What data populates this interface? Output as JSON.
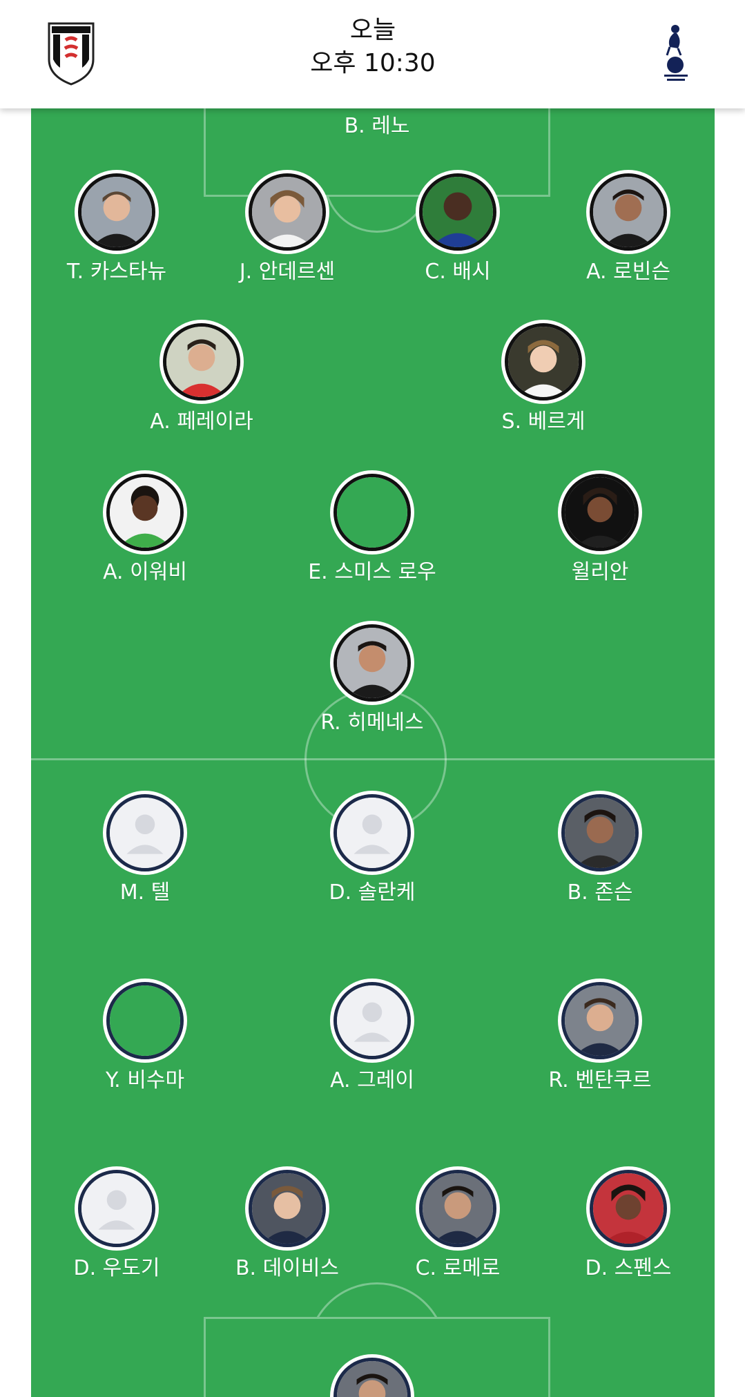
{
  "header": {
    "day_label": "오늘",
    "time_label": "오후 10:30",
    "home_logo_icon": "fulham-crest-icon",
    "away_logo_icon": "tottenham-crest-icon"
  },
  "colors": {
    "pitch": "#34a853",
    "home_ring": "#111111",
    "away_ring": "#1c2a4a"
  },
  "home_team": {
    "goalkeeper": {
      "name": "B. 레노"
    },
    "defenders": [
      {
        "name": "T. 카스타뉴"
      },
      {
        "name": "J. 안데르센"
      },
      {
        "name": "C. 배시"
      },
      {
        "name": "A. 로빈슨"
      }
    ],
    "midfield_pair": [
      {
        "name": "A. 페레이라"
      },
      {
        "name": "S. 베르게"
      }
    ],
    "attacking_mids": [
      {
        "name": "A. 이워비"
      },
      {
        "name": "E. 스미스 로우"
      },
      {
        "name": "윌리안"
      }
    ],
    "striker": {
      "name": "R. 히메네스"
    }
  },
  "away_team": {
    "forwards": [
      {
        "name": "M. 텔"
      },
      {
        "name": "D. 솔란케"
      },
      {
        "name": "B. 존슨"
      }
    ],
    "midfielders": [
      {
        "name": "Y. 비수마"
      },
      {
        "name": "A. 그레이"
      },
      {
        "name": "R. 벤탄쿠르"
      }
    ],
    "defenders": [
      {
        "name": "D. 우도기"
      },
      {
        "name": "B. 데이비스"
      },
      {
        "name": "C. 로메로"
      },
      {
        "name": "D. 스펜스"
      }
    ]
  }
}
